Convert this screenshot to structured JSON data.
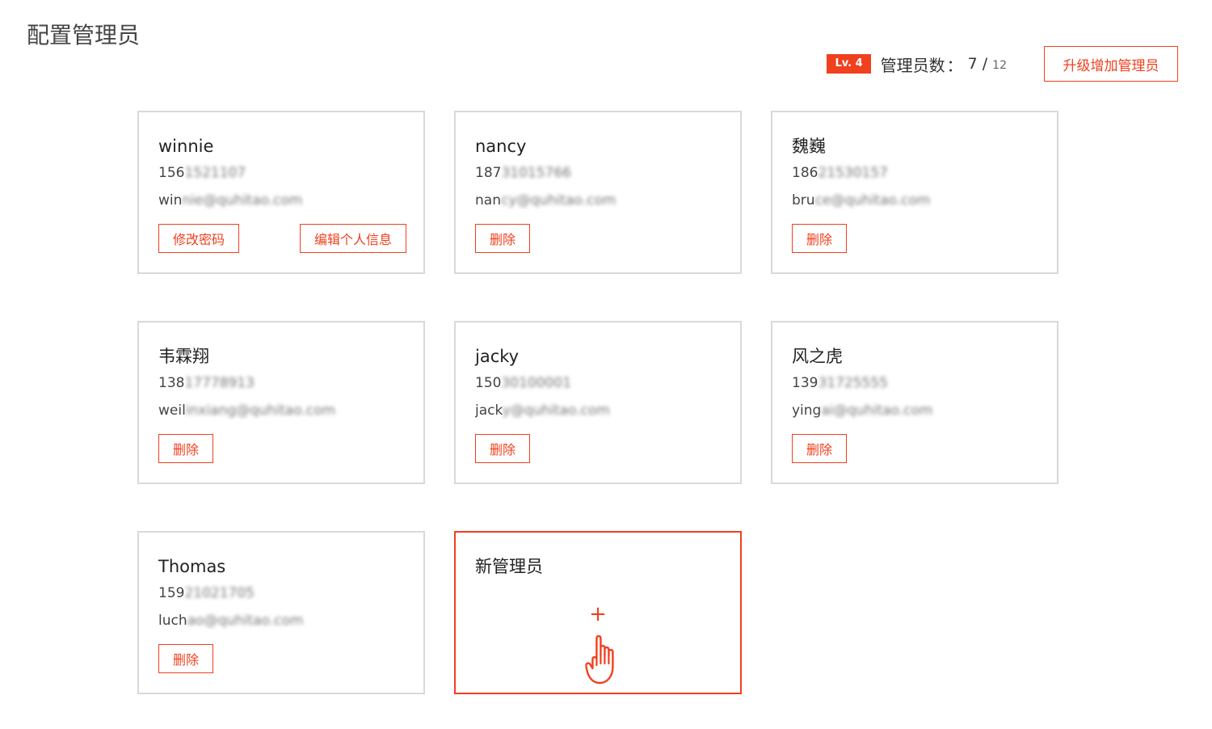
{
  "page": {
    "title": "配置管理员"
  },
  "header": {
    "level_badge": "Lv. 4",
    "count_label": "管理员数",
    "count_separator": "：",
    "count_used": "7",
    "count_slash": "/",
    "count_total": "12",
    "upgrade_button": "升级增加管理员"
  },
  "colors": {
    "accent": "#f0401e",
    "card_border": "#d9d9d9",
    "text": "#333333"
  },
  "admins": [
    {
      "name": "winnie",
      "phone_visible": "156",
      "phone_masked": "1521107",
      "email_visible": "win",
      "email_masked": "nie@quhitao.com",
      "actions": [
        "修改密码",
        "编辑个人信息"
      ]
    },
    {
      "name": "nancy",
      "phone_visible": "187",
      "phone_masked": "31015766",
      "email_visible": "nan",
      "email_masked": "cy@quhitao.com",
      "actions": [
        "删除"
      ]
    },
    {
      "name": "魏巍",
      "phone_visible": "186",
      "phone_masked": "21530157",
      "email_visible": "bru",
      "email_masked": "ce@quhitao.com",
      "actions": [
        "删除"
      ]
    },
    {
      "name": "韦霖翔",
      "phone_visible": "138",
      "phone_masked": "17778913",
      "email_visible": "weil",
      "email_masked": "inxiang@quhitao.com",
      "actions": [
        "删除"
      ]
    },
    {
      "name": "jacky",
      "phone_visible": "150",
      "phone_masked": "30100001",
      "email_visible": "jack",
      "email_masked": "y@quhitao.com",
      "actions": [
        "删除"
      ]
    },
    {
      "name": "风之虎",
      "phone_visible": "139",
      "phone_masked": "31725555",
      "email_visible": "ying",
      "email_masked": "ai@quhitao.com",
      "actions": [
        "删除"
      ]
    },
    {
      "name": "Thomas",
      "phone_visible": "159",
      "phone_masked": "21021705",
      "email_visible": "luch",
      "email_masked": "ao@quhitao.com",
      "actions": [
        "删除"
      ]
    }
  ],
  "new_admin": {
    "label": "新管理员",
    "plus": "+",
    "icon": "hand-pointer-icon"
  }
}
